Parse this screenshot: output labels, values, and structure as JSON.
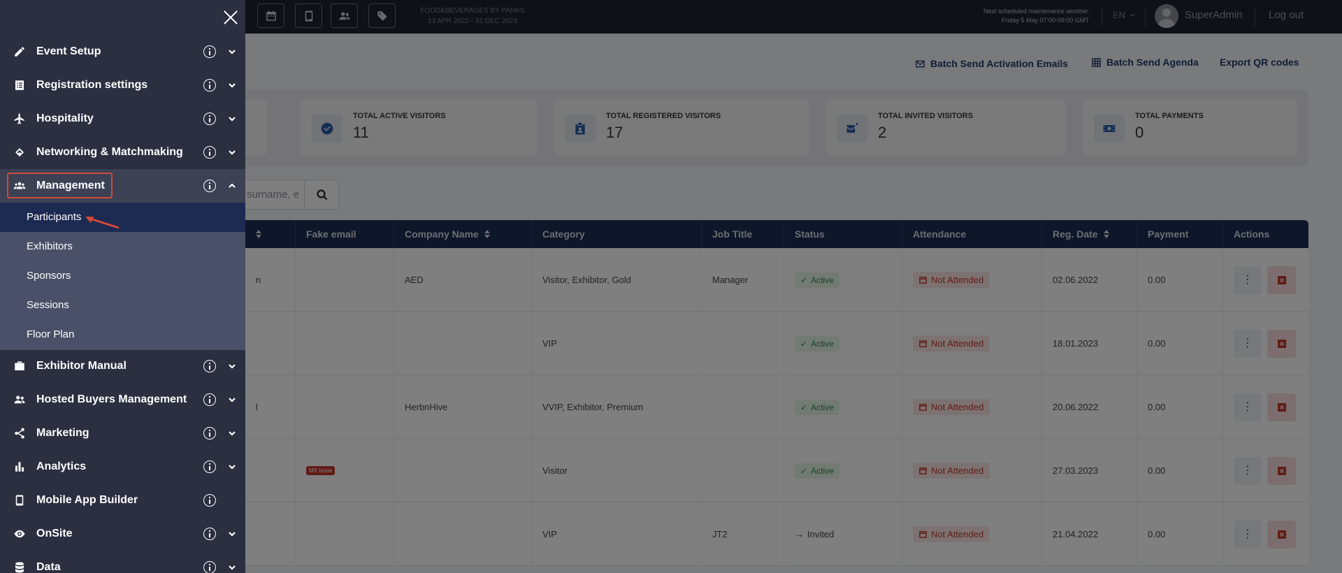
{
  "topbar": {
    "event_name": "FOOD&BEVERAGES BY PANKS",
    "event_dates": "13 APR 2022 - 31 DEC 2023",
    "maintenance_title": "Next scheduled maintenance window:",
    "maintenance_time": "Friday 5 May 07:00-09:00 GMT",
    "language": "EN",
    "user_name": "SuperAdmin",
    "logout_label": "Log out"
  },
  "actions": {
    "batch_activation": "Batch Send Activation Emails",
    "batch_agenda": "Batch Send Agenda",
    "export_qr": "Export QR codes"
  },
  "stats": [
    {
      "label": "TOTAL ACTIVE VISITORS",
      "value": "11",
      "icon": "check-circle-icon"
    },
    {
      "label": "TOTAL REGISTERED VISITORS",
      "value": "17",
      "icon": "badge-icon"
    },
    {
      "label": "TOTAL INVITED VISITORS",
      "value": "2",
      "icon": "envelope-icon"
    },
    {
      "label": "TOTAL PAYMENTS",
      "value": "0",
      "icon": "money-icon"
    }
  ],
  "search": {
    "placeholder": "surname, e"
  },
  "table": {
    "columns": [
      "Fake email",
      "Company Name",
      "Category",
      "Job Title",
      "Status",
      "Attendance",
      "Reg. Date",
      "Payment",
      "Actions"
    ],
    "rows": [
      {
        "name_fragment": "n",
        "fake_email": "",
        "company": "AED",
        "category": "Visitor, Exhibitor, Gold",
        "job_title": "Manager",
        "status": "Active",
        "attendance": "Not Attended",
        "reg_date": "02.06.2022",
        "payment": "0.00"
      },
      {
        "name_fragment": "",
        "fake_email": "",
        "company": "",
        "category": "VIP",
        "job_title": "",
        "status": "Active",
        "attendance": "Not Attended",
        "reg_date": "18.01.2023",
        "payment": "0.00"
      },
      {
        "name_fragment": "l",
        "fake_email": "",
        "company": "HerbnHive",
        "category": "VVIP, Exhibitor, Premium",
        "job_title": "",
        "status": "Active",
        "attendance": "Not Attended",
        "reg_date": "20.06.2022",
        "payment": "0.00"
      },
      {
        "name_fragment": "",
        "fake_email": "MX Issue",
        "company": "",
        "category": "Visitor",
        "job_title": "",
        "status": "Active",
        "attendance": "Not Attended",
        "reg_date": "27.03.2023",
        "payment": "0.00"
      },
      {
        "name_fragment": "",
        "fake_email": "",
        "company": "",
        "category": "VIP",
        "job_title": "JT2",
        "status": "Invited",
        "attendance": "Not Attended",
        "reg_date": "21.04.2022",
        "payment": "0.00"
      }
    ]
  },
  "sidebar": {
    "items": [
      {
        "label": "Event Setup",
        "icon": "pencil-icon",
        "info": true,
        "chevron": "down"
      },
      {
        "label": "Registration settings",
        "icon": "list-icon",
        "info": true,
        "chevron": "down"
      },
      {
        "label": "Hospitality",
        "icon": "plane-icon",
        "info": true,
        "chevron": "down"
      },
      {
        "label": "Networking & Matchmaking",
        "icon": "handshake-icon",
        "info": true,
        "chevron": "down"
      },
      {
        "label": "Management",
        "icon": "users-icon",
        "info": true,
        "chevron": "up"
      },
      {
        "label": "Exhibitor Manual",
        "icon": "briefcase-icon",
        "info": true,
        "chevron": "down"
      },
      {
        "label": "Hosted Buyers Management",
        "icon": "users-icon",
        "info": true,
        "chevron": "down"
      },
      {
        "label": "Marketing",
        "icon": "share-icon",
        "info": true,
        "chevron": "down"
      },
      {
        "label": "Analytics",
        "icon": "bar-chart-icon",
        "info": true,
        "chevron": "down"
      },
      {
        "label": "Mobile App Builder",
        "icon": "mobile-icon",
        "info": true,
        "chevron": "none"
      },
      {
        "label": "OnSite",
        "icon": "eye-icon",
        "info": true,
        "chevron": "down"
      },
      {
        "label": "Data",
        "icon": "database-icon",
        "info": true,
        "chevron": "down"
      }
    ],
    "management_submenu": [
      "Participants",
      "Exhibitors",
      "Sponsors",
      "Sessions",
      "Floor Plan"
    ]
  }
}
